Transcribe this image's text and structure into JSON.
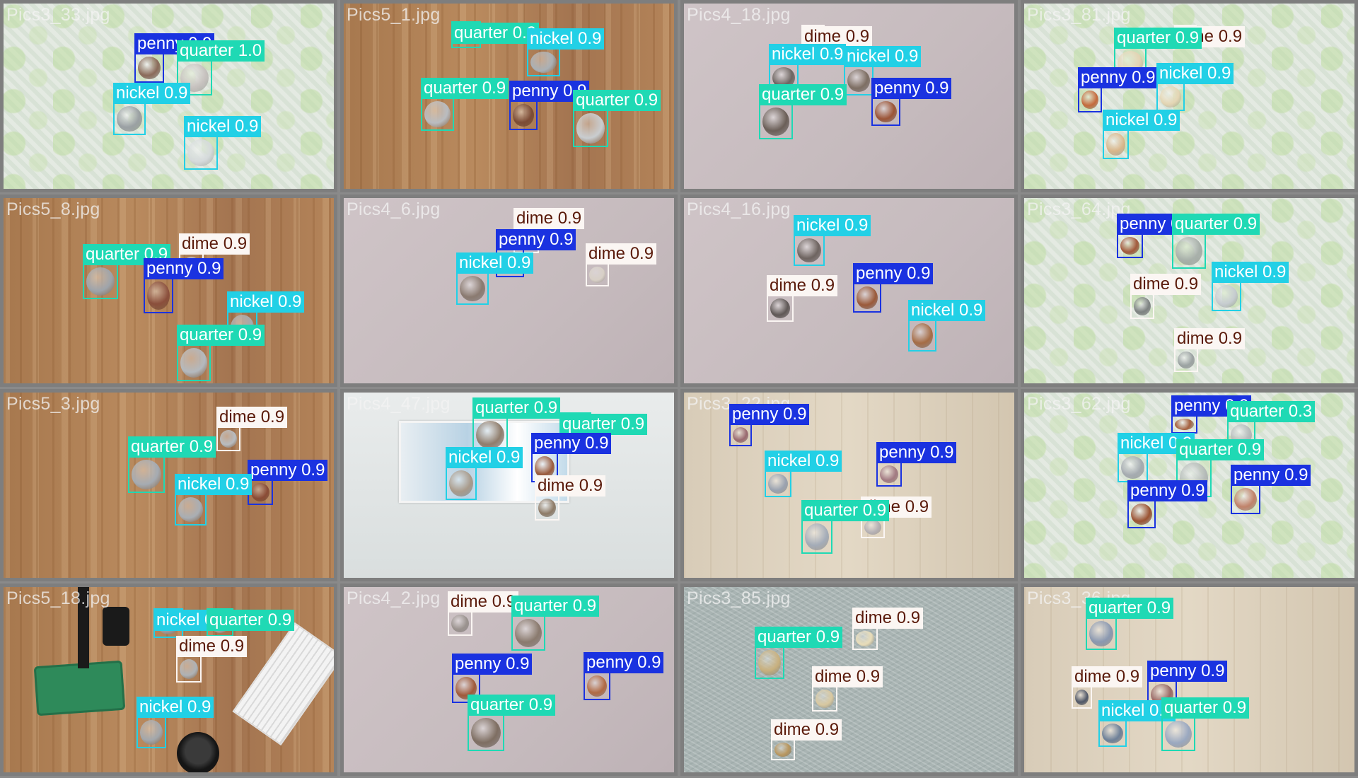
{
  "tiles": [
    {
      "filename": "Pics3_33.jpg",
      "bg": "fabric",
      "detections": [
        {
          "cls": "penny",
          "score": "0.9",
          "coin": "#8a6a5a"
        },
        {
          "cls": "quarter",
          "score": "1.0",
          "coin": "#c7c2bf"
        },
        {
          "cls": "nickel",
          "score": "0.9",
          "coin": "#9aa0a3"
        },
        {
          "cls": "nickel",
          "score": "0.9",
          "coin": "#d5dadb"
        }
      ]
    },
    {
      "filename": "Pics5_1.jpg",
      "bg": "wood",
      "detections": [
        {
          "cls": "quarter",
          "score": "0.9",
          "coin": "#a9a7a5"
        },
        {
          "cls": "nickel",
          "score": "0.9",
          "coin": "#aab0b5"
        },
        {
          "cls": "quarter",
          "score": "0.9",
          "coin": "#b9bcc0"
        },
        {
          "cls": "penny",
          "score": "0.9",
          "coin": "#7b4b35"
        },
        {
          "cls": "quarter",
          "score": "0.9",
          "coin": "#c9cdd0"
        }
      ]
    },
    {
      "filename": "Pics4_18.jpg",
      "bg": "mauve",
      "detections": [
        {
          "cls": "dime",
          "score": "0.9",
          "coin": "#8e8e8e"
        },
        {
          "cls": "nickel",
          "score": "0.9",
          "coin": "#6d6561"
        },
        {
          "cls": "nickel",
          "score": "0.9",
          "coin": "#7d6e63"
        },
        {
          "cls": "quarter",
          "score": "0.9",
          "coin": "#6b5f58"
        },
        {
          "cls": "penny",
          "score": "0.9",
          "coin": "#9b5436"
        }
      ]
    },
    {
      "filename": "Pics3_81.jpg",
      "bg": "fabric",
      "detections": [
        {
          "cls": "dime",
          "score": "0.9",
          "coin": "#c8c0b0"
        },
        {
          "cls": "quarter",
          "score": "0.9",
          "coin": "#e3d3b3"
        },
        {
          "cls": "penny",
          "score": "0.9",
          "coin": "#c46a3c"
        },
        {
          "cls": "nickel",
          "score": "0.9",
          "coin": "#e4d6b4"
        },
        {
          "cls": "nickel",
          "score": "0.9",
          "coin": "#d9b68a"
        }
      ]
    },
    {
      "filename": "Pics5_8.jpg",
      "bg": "wood",
      "detections": [
        {
          "cls": "quarter",
          "score": "0.9",
          "coin": "#9ea4ab"
        },
        {
          "cls": "dime",
          "score": "0.9",
          "coin": "#b5b7ba"
        },
        {
          "cls": "penny",
          "score": "0.9",
          "coin": "#8a4e3b"
        },
        {
          "cls": "nickel",
          "score": "0.9",
          "coin": "#a5aab0"
        },
        {
          "cls": "quarter",
          "score": "0.9",
          "coin": "#b4b9be"
        }
      ]
    },
    {
      "filename": "Pics4_6.jpg",
      "bg": "mauve",
      "detections": [
        {
          "cls": "dime",
          "score": "0.9",
          "coin": "#a6a09c"
        },
        {
          "cls": "penny",
          "score": "0.9",
          "coin": "#8c5a40"
        },
        {
          "cls": "dime",
          "score": "0.9",
          "coin": "#d8d0c6"
        },
        {
          "cls": "nickel",
          "score": "0.9",
          "coin": "#8a7a70"
        }
      ]
    },
    {
      "filename": "Pics4_16.jpg",
      "bg": "mauve",
      "detections": [
        {
          "cls": "nickel",
          "score": "0.9",
          "coin": "#6e6460"
        },
        {
          "cls": "dime",
          "score": "0.9",
          "coin": "#5f5856"
        },
        {
          "cls": "penny",
          "score": "0.9",
          "coin": "#9a5a3a"
        },
        {
          "cls": "nickel",
          "score": "0.9",
          "coin": "#a56c45"
        }
      ]
    },
    {
      "filename": "Pics3_64.jpg",
      "bg": "fabric",
      "detections": [
        {
          "cls": "penny",
          "score": "0.9",
          "coin": "#a25a3c"
        },
        {
          "cls": "quarter",
          "score": "0.9",
          "coin": "#a8b0aa"
        },
        {
          "cls": "dime",
          "score": "0.9",
          "coin": "#7c8180"
        },
        {
          "cls": "nickel",
          "score": "0.9",
          "coin": "#c6ccd0"
        },
        {
          "cls": "dime",
          "score": "0.9",
          "coin": "#9ba2a2"
        }
      ]
    },
    {
      "filename": "Pics5_3.jpg",
      "bg": "wood",
      "detections": [
        {
          "cls": "quarter",
          "score": "0.9",
          "coin": "#a5abb2"
        },
        {
          "cls": "dime",
          "score": "0.9",
          "coin": "#b8bcc0"
        },
        {
          "cls": "penny",
          "score": "0.9",
          "coin": "#8a4c36"
        },
        {
          "cls": "nickel",
          "score": "0.9",
          "coin": "#a9aeb4"
        }
      ]
    },
    {
      "filename": "Pics4_47.jpg",
      "bg": "paper",
      "detections": [
        {
          "cls": "quarter",
          "score": "0.9",
          "coin": "#8f7d6c"
        },
        {
          "cls": "quarter",
          "score": "0.9",
          "coin": "#9a8670"
        },
        {
          "cls": "nickel",
          "score": "0.9",
          "coin": "#a89a8a"
        },
        {
          "cls": "penny",
          "score": "0.9",
          "coin": "#9a5a3c"
        },
        {
          "cls": "dime",
          "score": "0.9",
          "coin": "#8d7a66"
        }
      ]
    },
    {
      "filename": "Pics3_22.jpg",
      "bg": "floor",
      "detections": [
        {
          "cls": "penny",
          "score": "0.9",
          "coin": "#9a6a70"
        },
        {
          "cls": "penny",
          "score": "0.9",
          "coin": "#a27a82"
        },
        {
          "cls": "nickel",
          "score": "0.9",
          "coin": "#9aa2b0"
        },
        {
          "cls": "dime",
          "score": "0.9",
          "coin": "#b4b0b4"
        },
        {
          "cls": "quarter",
          "score": "0.9",
          "coin": "#a4acb8"
        }
      ]
    },
    {
      "filename": "Pics3_62.jpg",
      "bg": "fabric",
      "detections": [
        {
          "cls": "penny",
          "score": "0.9",
          "coin": "#a5603e"
        },
        {
          "cls": "quarter",
          "score": "0.3",
          "coin": "#b6bcbc"
        },
        {
          "cls": "nickel",
          "score": "0.9",
          "coin": "#a5abb0"
        },
        {
          "cls": "quarter",
          "score": "0.9",
          "coin": "#b4bab8"
        },
        {
          "cls": "penny",
          "score": "0.9",
          "coin": "#c0826a"
        },
        {
          "cls": "penny",
          "score": "0.9",
          "coin": "#9a5232"
        }
      ]
    },
    {
      "filename": "Pics5_18.jpg",
      "bg": "wood",
      "detections": [
        {
          "cls": "nickel",
          "score": "0.9",
          "coin": "#9ea3a8"
        },
        {
          "cls": "quarter",
          "score": "0.9",
          "coin": "#b3b7bb"
        },
        {
          "cls": "dime",
          "score": "0.9",
          "coin": "#aeb2b6"
        },
        {
          "cls": "nickel",
          "score": "0.9",
          "coin": "#a2a7ac"
        }
      ]
    },
    {
      "filename": "Pics4_2.jpg",
      "bg": "mauve",
      "detections": [
        {
          "cls": "dime",
          "score": "0.9",
          "coin": "#9a928e"
        },
        {
          "cls": "quarter",
          "score": "0.9",
          "coin": "#8a7a6e"
        },
        {
          "cls": "penny",
          "score": "0.9",
          "coin": "#a05a3a"
        },
        {
          "cls": "penny",
          "score": "0.9",
          "coin": "#b06a44"
        },
        {
          "cls": "quarter",
          "score": "0.9",
          "coin": "#7e6e62"
        }
      ]
    },
    {
      "filename": "Pics3_85.jpg",
      "bg": "carpet",
      "detections": [
        {
          "cls": "dime",
          "score": "0.9",
          "coin": "#e8dcb8"
        },
        {
          "cls": "quarter",
          "score": "0.9",
          "coin": "#c8b07e"
        },
        {
          "cls": "dime",
          "score": "0.9",
          "coin": "#d8c8a0"
        },
        {
          "cls": "dime",
          "score": "0.9",
          "coin": "#b8965e"
        }
      ]
    },
    {
      "filename": "Pics3_36.jpg",
      "bg": "floor",
      "detections": [
        {
          "cls": "quarter",
          "score": "0.9",
          "coin": "#8a98b0"
        },
        {
          "cls": "penny",
          "score": "0.9",
          "coin": "#9a6a66"
        },
        {
          "cls": "dime",
          "score": "0.9",
          "coin": "#4e5666"
        },
        {
          "cls": "nickel",
          "score": "0.9",
          "coin": "#6e8098"
        },
        {
          "cls": "quarter",
          "score": "0.9",
          "coin": "#9aa8c0"
        }
      ]
    }
  ],
  "class_colors": {
    "penny": {
      "border": "#1a32e0",
      "bg": "#1a32e0",
      "text": "#ffffff"
    },
    "nickel": {
      "border": "#22d0e6",
      "bg": "#22d0e6",
      "text": "#ffffff"
    },
    "quarter": {
      "border": "#1fd9b4",
      "bg": "#1fd9b4",
      "text": "#ffffff"
    },
    "dime": {
      "border": "#fbf6f3",
      "bg": "#fbf6f3",
      "text": "#5a1a0a"
    }
  }
}
